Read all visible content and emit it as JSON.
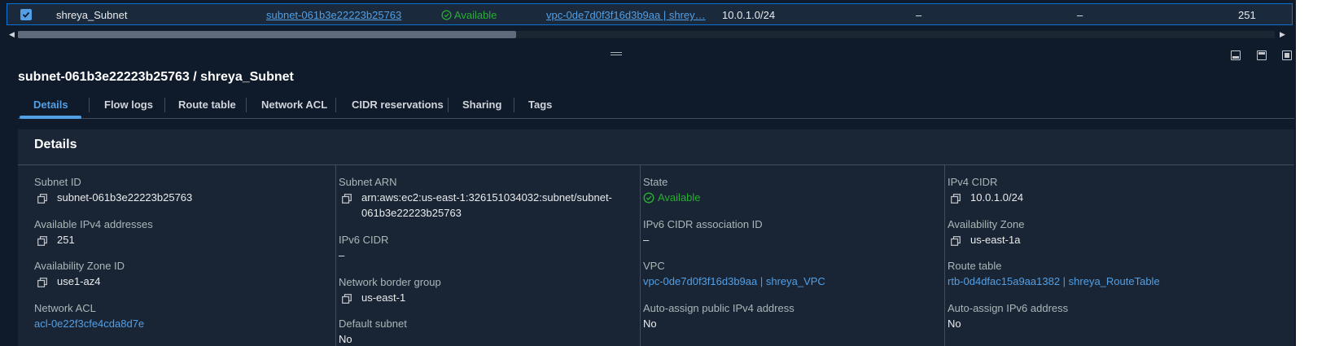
{
  "table_row": {
    "name": "shreya_Subnet",
    "subnet_id": "subnet-061b3e22223b25763",
    "state": "Available",
    "vpc": "vpc-0de7d0f3f16d3b9aa | shrey…",
    "ipv4_cidr": "10.0.1.0/24",
    "ipv6_cidr": "–",
    "ipv6_assoc": "–",
    "available_ips": "251"
  },
  "panel": {
    "title": "subnet-061b3e22223b25763 / shreya_Subnet",
    "tabs": [
      "Details",
      "Flow logs",
      "Route table",
      "Network ACL",
      "CIDR reservations",
      "Sharing",
      "Tags"
    ]
  },
  "details": {
    "heading": "Details",
    "col1": {
      "subnet_id_label": "Subnet ID",
      "subnet_id": "subnet-061b3e22223b25763",
      "available_ipv4_label": "Available IPv4 addresses",
      "available_ipv4": "251",
      "az_id_label": "Availability Zone ID",
      "az_id": "use1-az4",
      "nacl_label": "Network ACL",
      "nacl": "acl-0e22f3cfe4cda8d7e"
    },
    "col2": {
      "arn_label": "Subnet ARN",
      "arn_line1": "arn:aws:ec2:us-east-1:326151034032:subnet/subnet-",
      "arn_line2": "061b3e22223b25763",
      "ipv6_cidr_label": "IPv6 CIDR",
      "ipv6_cidr": "–",
      "border_group_label": "Network border group",
      "border_group": "us-east-1",
      "default_subnet_label": "Default subnet",
      "default_subnet": "No"
    },
    "col3": {
      "state_label": "State",
      "state": "Available",
      "ipv6_assoc_label": "IPv6 CIDR association ID",
      "ipv6_assoc": "–",
      "vpc_label": "VPC",
      "vpc": "vpc-0de7d0f3f16d3b9aa | shreya_VPC",
      "auto_ipv4_label": "Auto-assign public IPv4 address",
      "auto_ipv4": "No"
    },
    "col4": {
      "ipv4_cidr_label": "IPv4 CIDR",
      "ipv4_cidr": "10.0.1.0/24",
      "az_label": "Availability Zone",
      "az": "us-east-1a",
      "route_table_label": "Route table",
      "route_table": "rtb-0d4dfac15a9aa1382 | shreya_RouteTable",
      "auto_ipv6_label": "Auto-assign IPv6 address",
      "auto_ipv6": "No"
    }
  },
  "colors": {
    "background": "#0f1b2a",
    "card": "#192534",
    "link": "#539fe5",
    "success": "#29ad32",
    "text": "#e9ebed",
    "label": "#aab7b8"
  }
}
